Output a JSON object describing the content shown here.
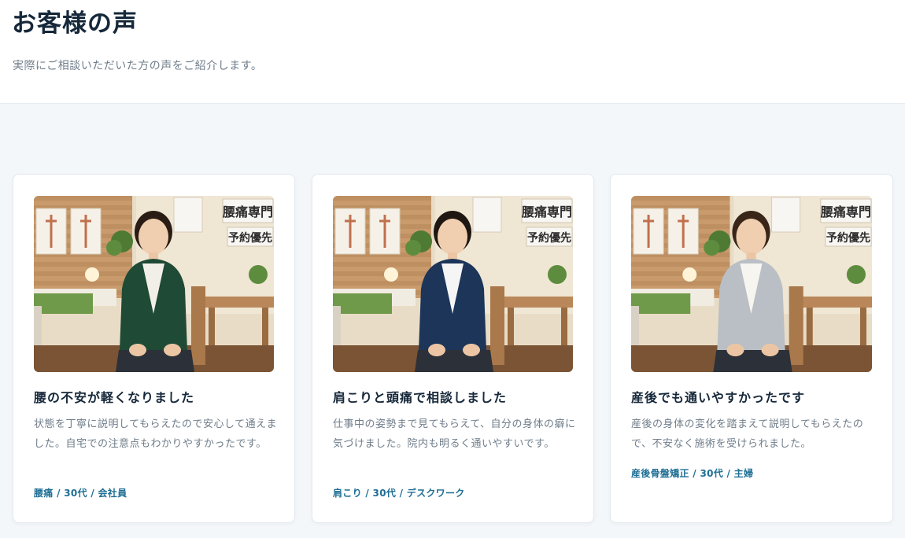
{
  "section": {
    "title": "お客様の声",
    "subtitle": "実際にご相談いただいた方の声をご紹介します。"
  },
  "testimonials": [
    {
      "title": "腰の不安が軽くなりました",
      "body": "状態を丁寧に説明してもらえたので安心して通えました。自宅での注意点もわかりやすかったです。",
      "meta": "腰痛 / 30代 / 会社員",
      "photo": {
        "sign_1": "腰痛専門",
        "sign_2": "予約優先",
        "jacket_color": "#1f4a35",
        "inner_color": "#f2efe8",
        "hair_color": "#2a1c14"
      }
    },
    {
      "title": "肩こりと頭痛で相談しました",
      "body": "仕事中の姿勢まで見てもらえて、自分の身体の癖に気づけました。院内も明るく通いやすいです。",
      "meta": "肩こり / 30代 / デスクワーク",
      "photo": {
        "sign_1": "腰痛専門",
        "sign_2": "予約優先",
        "jacket_color": "#1c3559",
        "inner_color": "#f5f5f5",
        "hair_color": "#1e1610"
      }
    },
    {
      "title": "産後でも通いやすかったです",
      "body": "産後の身体の変化を踏まえて説明してもらえたので、不安なく施術を受けられました。",
      "meta": "産後骨盤矯正 / 30代 / 主婦",
      "photo": {
        "sign_1": "腰痛専門",
        "sign_2": "予約優先",
        "jacket_color": "#b9bfc4",
        "inner_color": "#f7f5f0",
        "hair_color": "#3a2618"
      }
    }
  ]
}
